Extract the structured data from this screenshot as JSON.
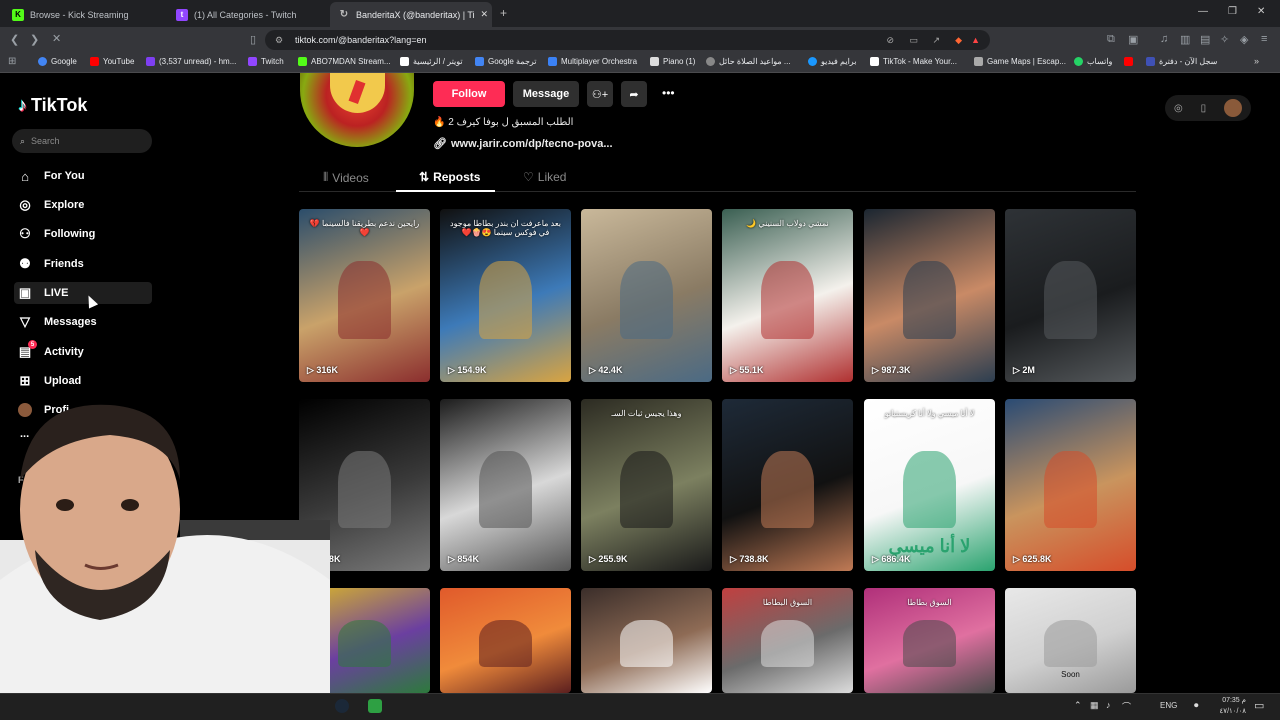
{
  "browser": {
    "tabs": [
      {
        "title": "Browse - Kick Streaming",
        "color": "#53fc18",
        "glyph": "K"
      },
      {
        "title": "(1) All Categories - Twitch",
        "color": "#9146ff",
        "glyph": "t"
      },
      {
        "title": "BanderitaX (@banderitax) | Ti",
        "color": "#ffffff",
        "glyph": "♪"
      }
    ],
    "new_tab": "+",
    "url": "tiktok.com/@banderitax?lang=en",
    "window_controls": [
      "—",
      "❐",
      "✕"
    ],
    "bookmarks": [
      {
        "label": "Google",
        "color": "#4285f4"
      },
      {
        "label": "YouTube",
        "color": "#ff0000"
      },
      {
        "label": "(3,537 unread) - hm...",
        "color": "#7e3ff2"
      },
      {
        "label": "Twitch",
        "color": "#9146ff"
      },
      {
        "label": "ABO7MDAN Stream...",
        "color": "#53fc18"
      },
      {
        "label": "تويتر / الرئيسية",
        "color": "#ffffff"
      },
      {
        "label": "Google ترجمة",
        "color": "#4285f4"
      },
      {
        "label": "Multiplayer Orchestra",
        "color": "#3b82f6"
      },
      {
        "label": "Piano (1)",
        "color": "#dddddd"
      },
      {
        "label": "مواعيد الصلاة حائل ...",
        "color": "#888888"
      },
      {
        "label": "برايم فيديو",
        "color": "#1a98ff"
      },
      {
        "label": "TikTok - Make Your...",
        "color": "#ffffff"
      },
      {
        "label": "Game Maps | Escap...",
        "color": "#aaaaaa"
      },
      {
        "label": "واتساب",
        "color": "#25d366"
      },
      {
        "label": "",
        "color": "#ff0000"
      },
      {
        "label": "سجل الآن - دفترة",
        "color": "#3f51b5"
      }
    ]
  },
  "tiktok": {
    "logo": "TikTok",
    "search_placeholder": "Search",
    "nav": [
      {
        "label": "For You",
        "icon": "home-icon",
        "glyph": "⌂"
      },
      {
        "label": "Explore",
        "icon": "compass-icon",
        "glyph": "◎"
      },
      {
        "label": "Following",
        "icon": "user-icon",
        "glyph": "⚇"
      },
      {
        "label": "Friends",
        "icon": "friends-icon",
        "glyph": "⚉"
      },
      {
        "label": "LIVE",
        "icon": "live-icon",
        "glyph": "▣"
      },
      {
        "label": "Messages",
        "icon": "paper-plane-icon",
        "glyph": "▽"
      },
      {
        "label": "Activity",
        "icon": "activity-icon",
        "glyph": "▤",
        "badge": "5"
      },
      {
        "label": "Upload",
        "icon": "upload-icon",
        "glyph": "⊞"
      },
      {
        "label": "Profi",
        "icon": "avatar-icon",
        "glyph": "●"
      }
    ],
    "more": "...",
    "following_heading": "F"
  },
  "profile": {
    "follow_label": "Follow",
    "message_label": "Message",
    "bio": "الطلب المسبق ل بوفا كيرف 2 🔥",
    "link": "www.jarir.com/dp/tecno-pova...",
    "tabs": [
      {
        "label": "Videos",
        "glyph": "⦀"
      },
      {
        "label": "Reposts",
        "glyph": "⇅"
      },
      {
        "label": "Liked",
        "glyph": "♡"
      }
    ]
  },
  "videos": [
    {
      "views": "316K",
      "caption": "رايحين ندعم بطريقنا فالسينما 💔❤️",
      "colors": [
        "#2b4d6b",
        "#c9a26a",
        "#8b2e2e"
      ]
    },
    {
      "views": "154.9K",
      "caption": "بعد ماعرفت ان بندر بطاطا موجود في فوكس سينما 😍🍿❤️",
      "colors": [
        "#101010",
        "#3d7ab8",
        "#d9a441"
      ]
    },
    {
      "views": "42.4K",
      "caption": "",
      "colors": [
        "#c9b89a",
        "#8a7b64",
        "#4b6a84"
      ]
    },
    {
      "views": "55.1K",
      "caption": "نمشي دولاب السنيني 🌙",
      "colors": [
        "#3a5f52",
        "#f4f1ec",
        "#b03030"
      ]
    },
    {
      "views": "987.3K",
      "caption": "",
      "colors": [
        "#1b2631",
        "#c98a66",
        "#2c3e50"
      ]
    },
    {
      "views": "2M",
      "caption": "",
      "colors": [
        "#2e3236",
        "#1a1c1e",
        "#55595c"
      ]
    },
    {
      "views": "83.8K",
      "caption": "",
      "colors": [
        "#000000",
        "#3a3a3a",
        "#7a7a7a"
      ]
    },
    {
      "views": "854K",
      "caption": "",
      "colors": [
        "#1c1c1c",
        "#d8d8d8",
        "#555555"
      ]
    },
    {
      "views": "255.9K",
      "caption": "وهذا يجيس ثبات السـ",
      "colors": [
        "#2c2b22",
        "#7c8060",
        "#1a1a1a"
      ]
    },
    {
      "views": "738.8K",
      "caption": "",
      "colors": [
        "#1e2a38",
        "#111111",
        "#c07a55"
      ]
    },
    {
      "views": "686.4K",
      "caption": "لا أنا ميسي ولا أنا كريستيانو",
      "caption2": "لا أنا ميسي",
      "colors": [
        "#ffffff",
        "#f7f7f7",
        "#2aa36f"
      ]
    },
    {
      "views": "625.8K",
      "caption": "",
      "colors": [
        "#2a4b74",
        "#c9945e",
        "#d64d2a"
      ]
    },
    {
      "views": "",
      "caption": "",
      "colors": [
        "#d8b42a",
        "#6b3fa0",
        "#2d7a3c"
      ]
    },
    {
      "views": "",
      "caption": "",
      "colors": [
        "#e05a2b",
        "#f08b3b",
        "#5c1f1f"
      ]
    },
    {
      "views": "",
      "caption": "",
      "colors": [
        "#3b2e2a",
        "#8e6b55",
        "#ffffff"
      ]
    },
    {
      "views": "",
      "caption": "السوق البطاطا",
      "colors": [
        "#c04040",
        "#6b6b6b",
        "#dcdcdc"
      ]
    },
    {
      "views": "",
      "caption": "السوق بطاطا",
      "colors": [
        "#b0307a",
        "#e070a0",
        "#4a4a4a"
      ]
    },
    {
      "views": "",
      "caption": "Soon",
      "colors": [
        "#e8e8e8",
        "#d0d0d0",
        "#9a9a9a"
      ]
    }
  ],
  "taskbar": {
    "lang": "ENG",
    "time": "07:35 م",
    "date": "٤٧/١٠/٠٨"
  }
}
